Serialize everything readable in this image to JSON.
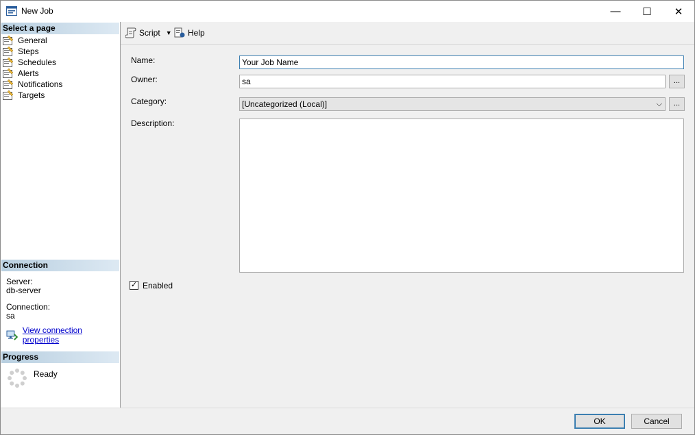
{
  "window": {
    "title": "New Job",
    "minimize_glyph": "—",
    "maximize_glyph": "☐",
    "close_glyph": "✕"
  },
  "sidebar": {
    "select_page_header": "Select a page",
    "pages": [
      {
        "label": "General",
        "icon": "page-icon"
      },
      {
        "label": "Steps",
        "icon": "page-icon"
      },
      {
        "label": "Schedules",
        "icon": "page-icon"
      },
      {
        "label": "Alerts",
        "icon": "page-icon"
      },
      {
        "label": "Notifications",
        "icon": "page-icon"
      },
      {
        "label": "Targets",
        "icon": "page-icon"
      }
    ],
    "connection_header": "Connection",
    "server_label": "Server:",
    "server_value": "db-server",
    "connection_label": "Connection:",
    "connection_value": "sa",
    "view_connection_link": "View connection properties",
    "progress_header": "Progress",
    "progress_status": "Ready"
  },
  "toolbar": {
    "script_label": "Script",
    "script_dropdown_glyph": "▼",
    "help_label": "Help"
  },
  "form": {
    "name_label": "Name:",
    "name_value": "Your Job Name",
    "owner_label": "Owner:",
    "owner_value": "sa",
    "browse_label": "...",
    "category_label": "Category:",
    "category_value": "[Uncategorized (Local)]",
    "combo_arrow": "⌵",
    "description_label": "Description:",
    "description_value": "",
    "enabled_label": "Enabled",
    "enabled_checked": true,
    "check_glyph": "✓"
  },
  "buttons": {
    "ok_label": "OK",
    "cancel_label": "Cancel"
  },
  "colors": {
    "link": "#0000cc",
    "section_header": "#b8cfe0",
    "focus_border": "#3c7fb1"
  }
}
